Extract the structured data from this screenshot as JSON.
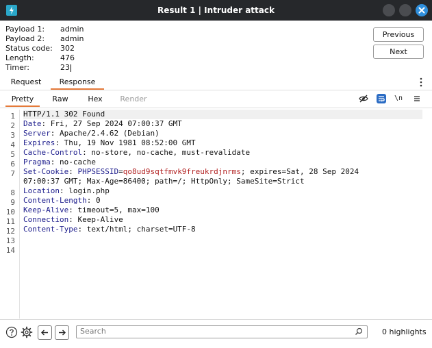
{
  "window": {
    "title": "Result 1 | Intruder attack",
    "icons": {
      "app": "burp-suite-icon",
      "minimize": "minimize-icon",
      "maximize": "maximize-icon",
      "close": "close-icon"
    },
    "accent_color": "#2f8fdc"
  },
  "info": {
    "rows": [
      {
        "label": "Payload 1:",
        "value": "admin"
      },
      {
        "label": "Payload 2:",
        "value": "admin"
      },
      {
        "label": "Status code:",
        "value": "302"
      },
      {
        "label": "Length:",
        "value": "476"
      },
      {
        "label": "Timer:",
        "value": "23"
      }
    ]
  },
  "nav": {
    "previous": "Previous",
    "next": "Next"
  },
  "tabs": {
    "request": "Request",
    "response": "Response",
    "active": "Response",
    "active_color": "#e57a3a"
  },
  "subtabs": {
    "pretty": "Pretty",
    "raw": "Raw",
    "hex": "Hex",
    "render": "Render",
    "active": "Pretty"
  },
  "toolbar": {
    "newline_label": "\\n",
    "icons": [
      "hide-icon",
      "wrap-lines-icon",
      "newline-icon",
      "menu-icon"
    ]
  },
  "response": {
    "lines": [
      {
        "num": "1",
        "text": "HTTP/1.1 302 Found"
      },
      {
        "num": "2",
        "key": "Date",
        "val": "Fri, 27 Sep 2024 07:00:37 GMT"
      },
      {
        "num": "3",
        "key": "Server",
        "val": "Apache/2.4.62 (Debian)"
      },
      {
        "num": "4",
        "key": "Expires",
        "val": "Thu, 19 Nov 1981 08:52:00 GMT"
      },
      {
        "num": "5",
        "key": "Cache-Control",
        "val": "no-store, no-cache, must-revalidate"
      },
      {
        "num": "6",
        "key": "Pragma",
        "val": "no-cache"
      },
      {
        "num": "7",
        "key": "Set-Cookie",
        "cookie_name": "PHPSESSID",
        "cookie_value": "qo8ud9sqtfmvk9freukrdjnrms",
        "rest": "; expires=Sat, 28 Sep 2024",
        "cont": "07:00:37 GMT; Max-Age=86400; path=/; HttpOnly; SameSite=Strict"
      },
      {
        "num": "8",
        "key": "Location",
        "val": "login.php"
      },
      {
        "num": "9",
        "key": "Content-Length",
        "val": "0"
      },
      {
        "num": "10",
        "key": "Keep-Alive",
        "val": "timeout=5, max=100"
      },
      {
        "num": "11",
        "key": "Connection",
        "val": "Keep-Alive"
      },
      {
        "num": "12",
        "key": "Content-Type",
        "val": "text/html; charset=UTF-8"
      },
      {
        "num": "13",
        "text": ""
      },
      {
        "num": "14",
        "text": ""
      }
    ],
    "header_key_color": "#1c1c8c",
    "cookie_value_color": "#b22222"
  },
  "bottom": {
    "search_placeholder": "Search",
    "highlights": "0 highlights",
    "icons": [
      "help-icon",
      "settings-icon",
      "back-arrow-icon",
      "forward-arrow-icon",
      "search-icon"
    ]
  }
}
